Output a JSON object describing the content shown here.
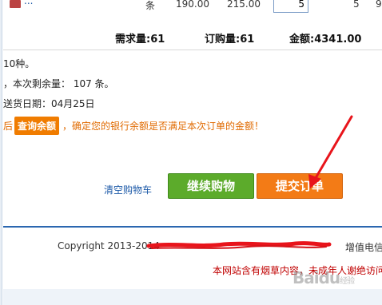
{
  "product_row": {
    "name": "...",
    "unit": "条",
    "price_a": "190.00",
    "price_b": "215.00",
    "quantity": "5",
    "col_qty2": "5",
    "col_qty3": "9"
  },
  "totals": {
    "demand_label": "需求量:61",
    "order_label": "订购量:61",
    "amount_label": "金额:4341.00"
  },
  "info": {
    "line1": "10种。",
    "line2": "，本次剩余量： 107 条。",
    "line3": "送货日期：04月25日",
    "line4_prefix": "后",
    "query_button": "查询余额",
    "line4_suffix": "，确定您的银行余额是否满足本次订单的金额！"
  },
  "actions": {
    "clear_cart": "清空购物车",
    "continue_shopping": "继续购物",
    "submit_order": "提交订单"
  },
  "footer": {
    "copyright": "Copyright 2013-2014",
    "right_text": "增值电信",
    "warning": "本网站含有烟草内容，未成年人谢绝访问"
  },
  "watermark": {
    "text": "Baidu",
    "sub": "经验"
  },
  "colors": {
    "link_blue": "#1d5aa8",
    "continue_green": "#5cab2b",
    "submit_orange": "#f37b16",
    "notice_orange": "#e06a00",
    "annotation_red": "#e8141b",
    "footer_blue": "#2b67b0",
    "warning_red": "#c00000"
  }
}
